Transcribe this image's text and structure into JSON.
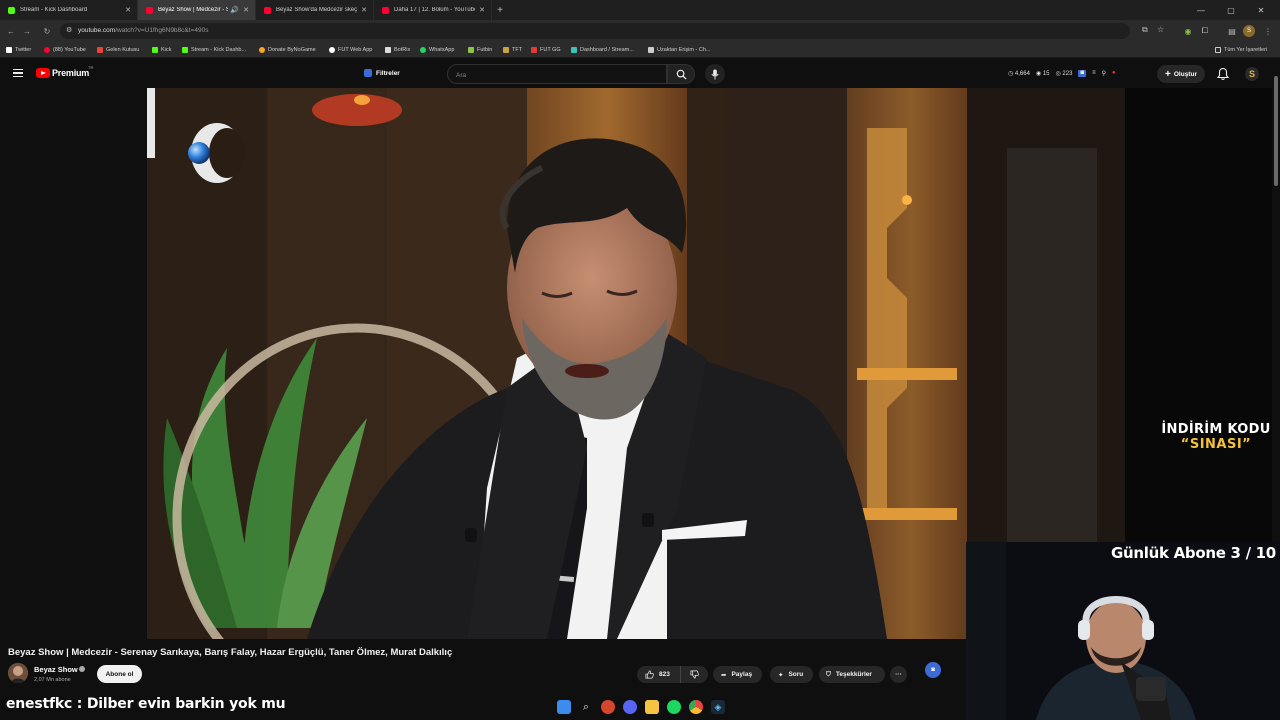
{
  "browser": {
    "tabs": [
      {
        "title": "Stream - Kick Dashboard",
        "favicon_color": "#53fc18",
        "active": false
      },
      {
        "title": "Beyaz Show | Medcezir - S...",
        "favicon_color": "#ff0033",
        "active": true
      },
      {
        "title": "Beyaz Show'da Medcezir skeç...",
        "favicon_color": "#ff0033",
        "active": false
      },
      {
        "title": "Daha 17 | 12. Bölüm - YouTube",
        "favicon_color": "#ff0033",
        "active": false
      }
    ],
    "url_host": "youtube.com",
    "url_path": "/watch?v=U1fhg6N9b8c&t=490s",
    "bookmarks": [
      {
        "label": "Twitter",
        "color": "#ffffff"
      },
      {
        "label": "(88) YouTube",
        "color": "#ff0033"
      },
      {
        "label": "Gelen Kutusu",
        "color": "#ea4335"
      },
      {
        "label": "Kick",
        "color": "#53fc18"
      },
      {
        "label": "Stream - Kick Dashb...",
        "color": "#53fc18"
      },
      {
        "label": "Donate ByNoGame",
        "color": "#f5a623"
      },
      {
        "label": "FUT Web App",
        "color": "#ffffff"
      },
      {
        "label": "BotRix",
        "color": "#ffffff"
      },
      {
        "label": "WhatsApp",
        "color": "#25d366"
      },
      {
        "label": "Futbin",
        "color": "#8bc34a"
      },
      {
        "label": "TFT",
        "color": "#c9a14a"
      },
      {
        "label": "FUT GG",
        "color": "#e53935"
      },
      {
        "label": "Dashboard / Stream...",
        "color": "#3ec2b6"
      },
      {
        "label": "Uzaktan Erişim - Ch...",
        "color": "#cccccc"
      }
    ],
    "bookmarks_all": "Tüm Yer İşaretleri"
  },
  "yt": {
    "brand": "Premium",
    "brand_region": "TR",
    "filters_label": "Filtreler",
    "search_placeholder": "Ara",
    "stats": {
      "viewers": "4,664",
      "shield": "15",
      "followers": "223"
    },
    "create_label": "Oluştur",
    "avatar_letter": "S"
  },
  "video": {
    "title": "Beyaz Show | Medcezir - Serenay Sarıkaya, Barış Falay, Hazar Ergüçlü, Taner Ölmez, Murat Dalkılıç",
    "channel_name": "Beyaz Show",
    "subscribers": "2,07 Mn abone",
    "subscribe_label": "Abone ol",
    "likes": "823",
    "share_label": "Paylaş",
    "ask_label": "Soru",
    "thanks_label": "Teşekkürler",
    "more_label": "···"
  },
  "overlay": {
    "promo_line1": "İNDİRİM KODU",
    "promo_line2": "“SINASI”",
    "goal": "Günlük Abone 3 / 10",
    "chat_message": "enestfkc : Dilber evin barkin yok mu"
  },
  "taskbar": [
    {
      "name": "windows-start",
      "color": "#3b8ced"
    },
    {
      "name": "search",
      "color": "#dddddd"
    },
    {
      "name": "app-red",
      "color": "#d6462f"
    },
    {
      "name": "discord",
      "color": "#5865f2"
    },
    {
      "name": "file-explorer",
      "color": "#f5c542"
    },
    {
      "name": "spotify",
      "color": "#1ed760"
    },
    {
      "name": "chrome",
      "color": "#e8453c"
    },
    {
      "name": "steam",
      "color": "#66c0f4"
    }
  ]
}
